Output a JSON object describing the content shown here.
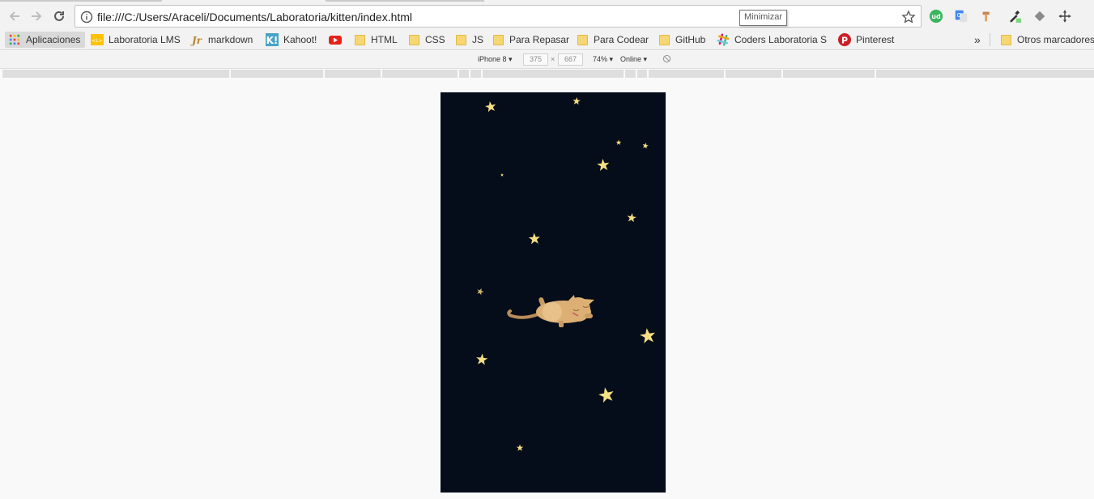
{
  "toolbar": {
    "url": "file:///C:/Users/Araceli/Documents/Laboratoria/kitten/index.html",
    "tooltip": "Minimizar"
  },
  "extensions": [
    "udemy-icon",
    "translate-icon",
    "hammer-icon",
    "eyedropper-icon",
    "layers-icon",
    "move-icon"
  ],
  "bookmarks": {
    "items": [
      {
        "label": "Aplicaciones",
        "icon": "apps-icon"
      },
      {
        "label": "Laboratoria LMS",
        "icon": "laboratoria-icon"
      },
      {
        "label": "markdown",
        "icon": "markdown-icon"
      },
      {
        "label": "Kahoot!",
        "icon": "kahoot-icon"
      },
      {
        "label": "",
        "icon": "youtube-icon"
      },
      {
        "label": "HTML",
        "icon": "folder-icon"
      },
      {
        "label": "CSS",
        "icon": "folder-icon"
      },
      {
        "label": "JS",
        "icon": "folder-icon"
      },
      {
        "label": "Para Repasar",
        "icon": "folder-icon"
      },
      {
        "label": "Para Codear",
        "icon": "folder-icon"
      },
      {
        "label": "GitHub",
        "icon": "folder-icon"
      },
      {
        "label": "Coders Laboratoria S",
        "icon": "slack-icon"
      },
      {
        "label": "Pinterest",
        "icon": "pinterest-icon"
      }
    ],
    "overflow": "»",
    "other": "Otros marcadores"
  },
  "device_toolbar": {
    "device": "iPhone 8",
    "width": "375",
    "x": "×",
    "height": "667",
    "zoom": "74%",
    "network": "Online"
  },
  "colors": {
    "sky": "#060d1a",
    "star": "#f6df82",
    "cat_body": "#dcb074",
    "cat_tail": "#b98c58"
  }
}
